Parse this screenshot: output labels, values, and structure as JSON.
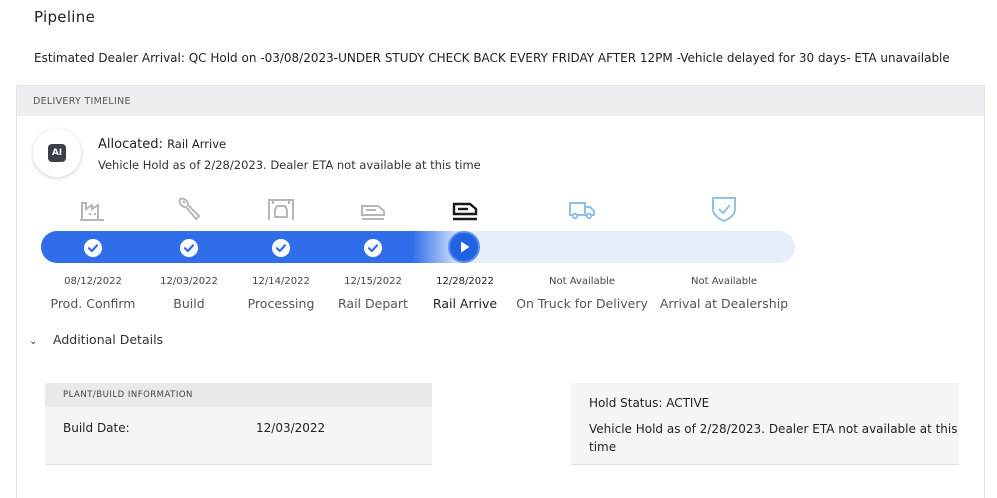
{
  "page": {
    "title": "Pipeline",
    "eta_line": "Estimated Dealer Arrival: QC Hold on -03/08/2023-UNDER STUDY CHECK BACK EVERY FRIDAY AFTER 12PM -Vehicle delayed for 30 days- ETA unavailable"
  },
  "timeline": {
    "header": "DELIVERY TIMELINE",
    "allocated": {
      "avatar_text": "AI",
      "label": "Allocated:",
      "value": "Rail Arrive",
      "subtitle": "Vehicle Hold as of 2/28/2023. Dealer ETA not available at this time"
    },
    "progress_fraction": 0.56,
    "steps": [
      {
        "date": "08/12/2022",
        "label": "Prod. Confirm",
        "status": "complete",
        "icon": "factory-icon"
      },
      {
        "date": "12/03/2022",
        "label": "Build",
        "status": "complete",
        "icon": "wrench-icon"
      },
      {
        "date": "12/14/2022",
        "label": "Processing",
        "status": "complete",
        "icon": "car-wash-icon"
      },
      {
        "date": "12/15/2022",
        "label": "Rail Depart",
        "status": "complete",
        "icon": "rail-car-icon"
      },
      {
        "date": "12/28/2022",
        "label": "Rail Arrive",
        "status": "current",
        "icon": "rail-car-icon"
      },
      {
        "date": "Not Available",
        "label": "On Truck for Delivery",
        "status": "pending",
        "icon": "truck-icon"
      },
      {
        "date": "Not Available",
        "label": "Arrival at Dealership",
        "status": "pending",
        "icon": "shield-check-icon"
      }
    ]
  },
  "details": {
    "toggle_label": "Additional Details",
    "plant": {
      "header": "PLANT/BUILD INFORMATION",
      "build_date_label": "Build Date:",
      "build_date_value": "12/03/2022"
    },
    "hold": {
      "status": "Hold Status: ACTIVE",
      "description": "Vehicle Hold as of 2/28/2023. Dealer ETA not available at this time"
    }
  },
  "colors": {
    "progress_blue": "#2f6ee8",
    "track_light": "#e6eefc",
    "done_icon_gray": "#b4b7bc",
    "pending_icon_blue": "#8dc3ea"
  }
}
